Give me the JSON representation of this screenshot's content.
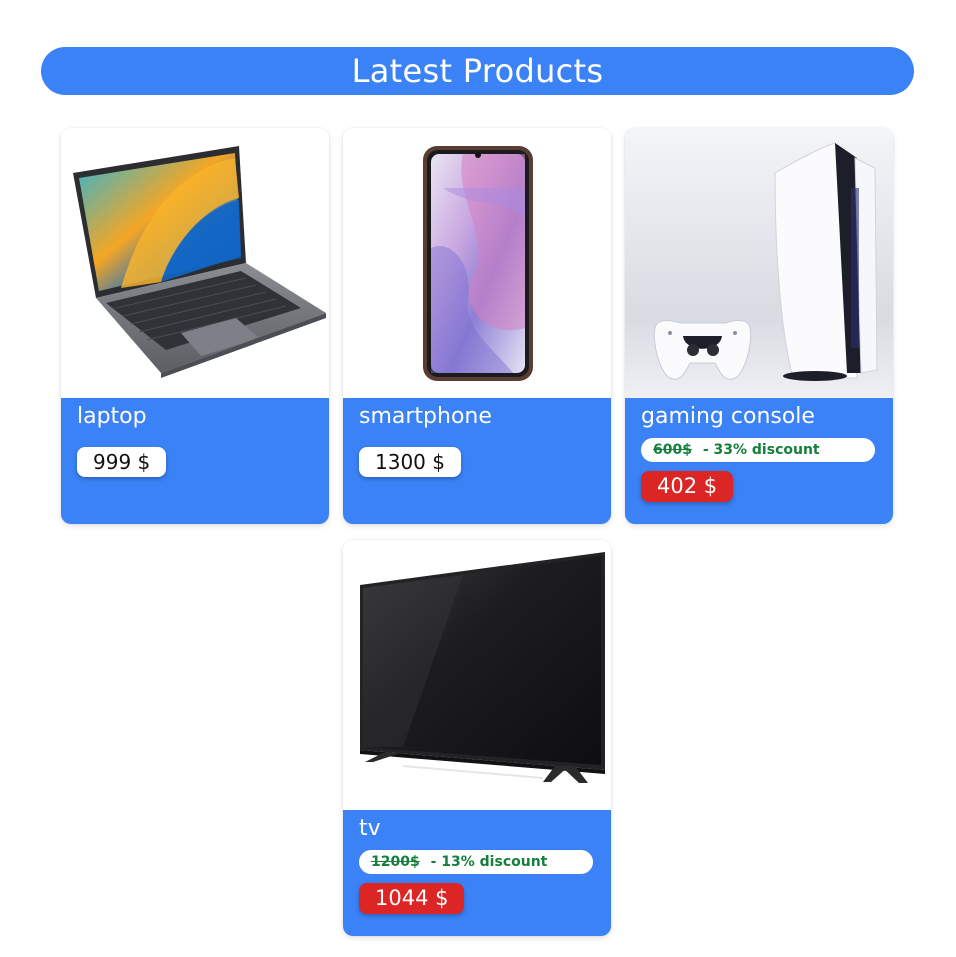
{
  "header": {
    "title": "Latest Products"
  },
  "products": [
    {
      "name": "laptop",
      "price": "999 $",
      "image_icon": "laptop-image"
    },
    {
      "name": "smartphone",
      "price": "1300 $",
      "image_icon": "smartphone-image"
    },
    {
      "name": "gaming console",
      "old_price": "600$",
      "discount_text": "- 33% discount",
      "sale_price": "402 $",
      "image_icon": "gaming-console-image"
    },
    {
      "name": "tv",
      "old_price": "1200$",
      "discount_text": "- 13% discount",
      "sale_price": "1044 $",
      "image_icon": "tv-image"
    }
  ],
  "colors": {
    "accent": "#3b82f6",
    "sale": "#dc2626",
    "discount_text": "#15803d"
  }
}
